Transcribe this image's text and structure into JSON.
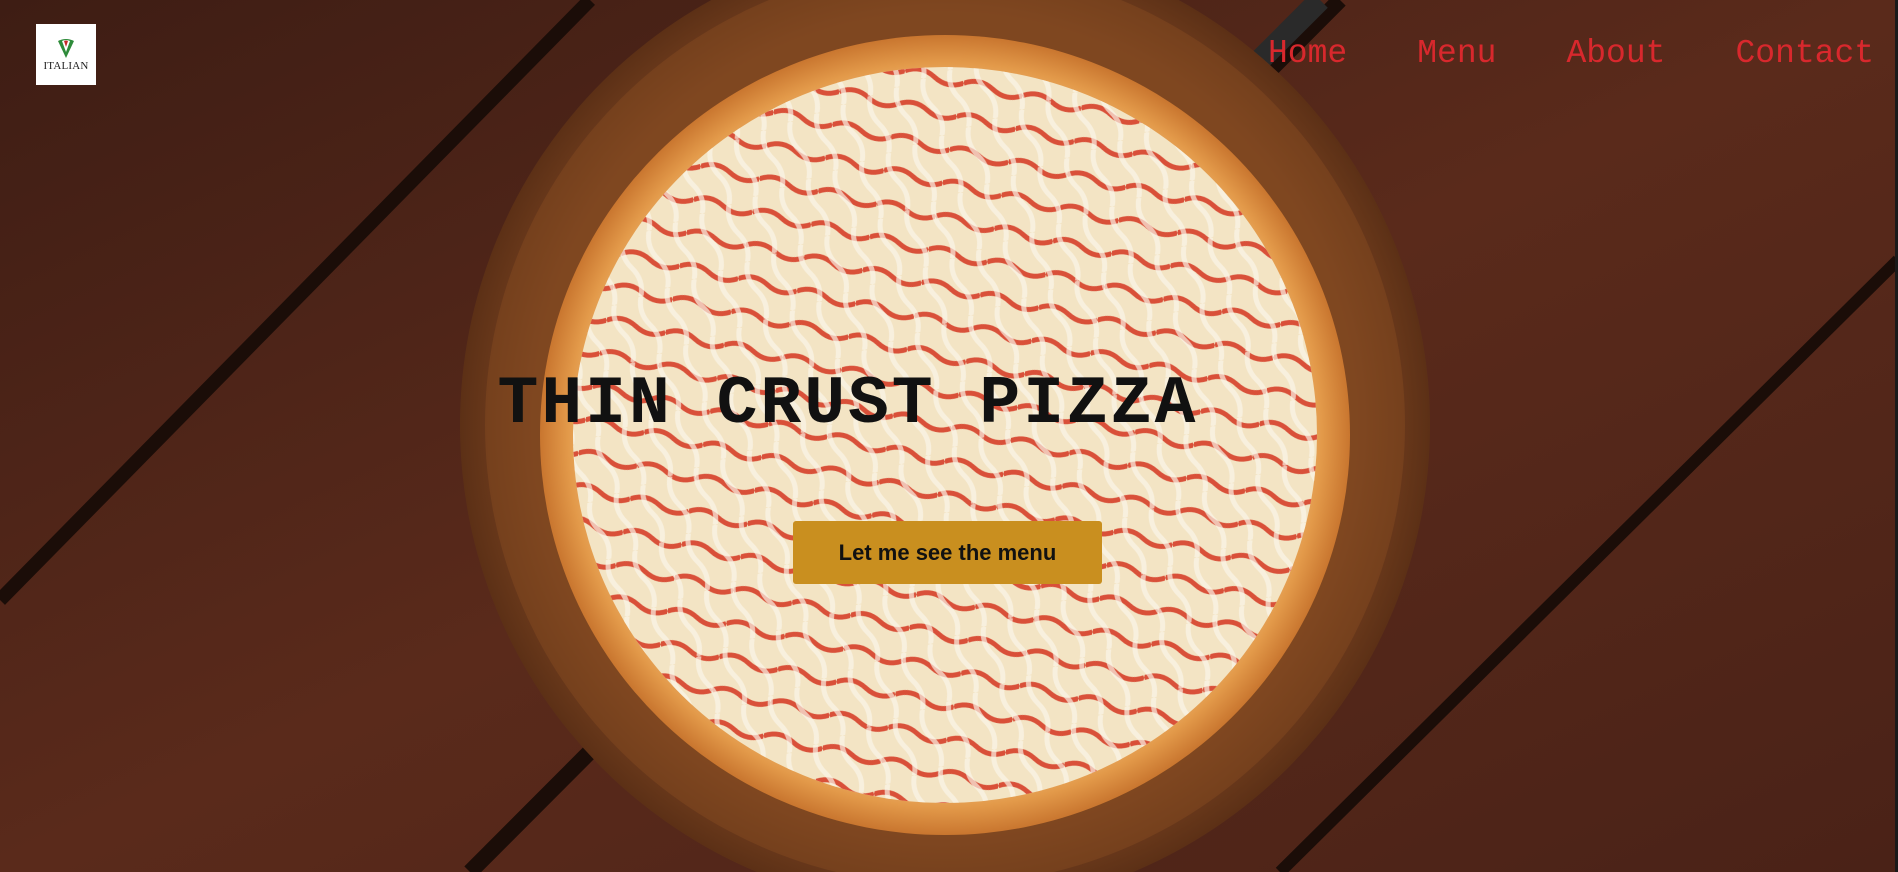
{
  "brand": {
    "logo_text": "ITALIAN",
    "logo_icon": "pizza-slice-icon"
  },
  "nav": {
    "items": [
      {
        "label": "Home"
      },
      {
        "label": "Menu"
      },
      {
        "label": "About"
      },
      {
        "label": "Contact"
      }
    ],
    "link_color": "#d8282d"
  },
  "hero": {
    "title": "THIN CRUST PIZZA",
    "cta_label": "Let me see the menu",
    "cta_color": "#c98f1f",
    "background_image": "pizza on wooden board over wooden table"
  }
}
